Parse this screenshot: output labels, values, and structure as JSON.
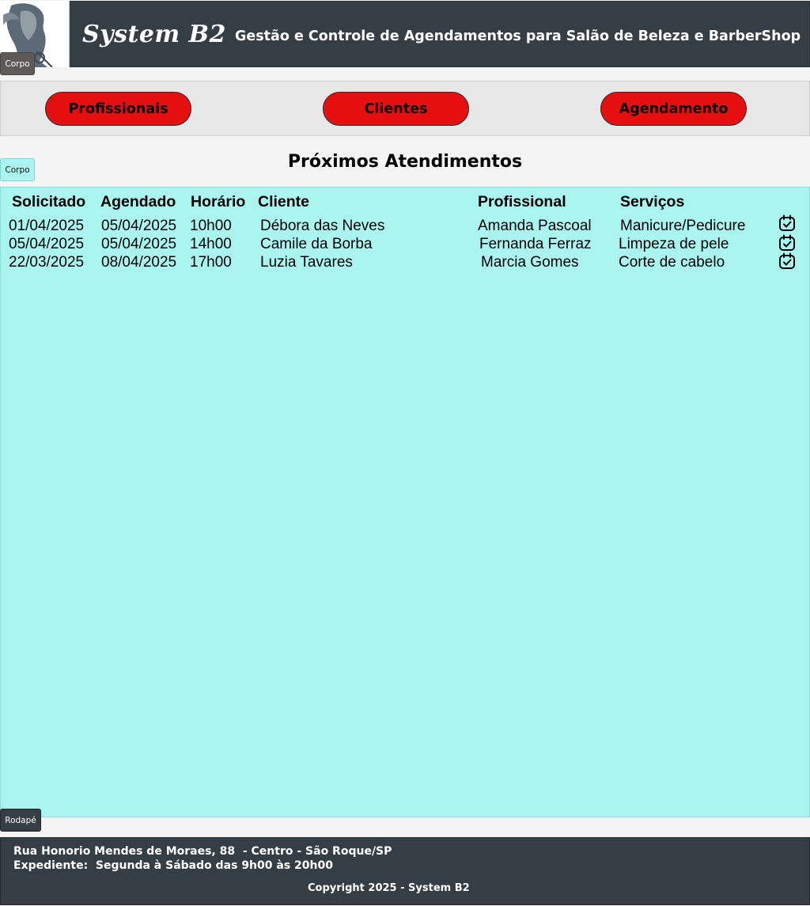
{
  "header": {
    "brand": "System B2",
    "tagline": "Gestão e Controle de Agendamentos para Salão de Beleza e BarberShop",
    "logo_icon": "salon-logo-icon",
    "tag_label": "Corpo"
  },
  "nav": {
    "buttons": [
      {
        "label": "Profissionais"
      },
      {
        "label": "Clientes"
      },
      {
        "label": "Agendamento"
      }
    ],
    "button_color": "#e60f10"
  },
  "body_tag": "Corpo",
  "section_title": "Próximos Atendimentos",
  "table": {
    "headers": {
      "solicitado": "Solicitado",
      "agendado": "Agendado",
      "horario": "Horário",
      "cliente": "Cliente",
      "profissional": "Profissional",
      "servicos": "Serviços"
    },
    "rows": [
      {
        "solicitado": "01/04/2025",
        "agendado": "05/04/2025",
        "horario": "10h00",
        "cliente": "Débora das Neves",
        "profissional": "Amanda Pascoal",
        "servico": "Manicure/Pedicure",
        "action_icon": "calendar-check-icon"
      },
      {
        "solicitado": "05/04/2025",
        "agendado": "05/04/2025",
        "horario": "14h00",
        "cliente": "Camile da Borba",
        "profissional": "Fernanda Ferraz",
        "servico": "Limpeza de pele",
        "action_icon": "calendar-check-icon"
      },
      {
        "solicitado": "22/03/2025",
        "agendado": "08/04/2025",
        "horario": "17h00",
        "cliente": "Luzia Tavares",
        "profissional": "Marcia Gomes",
        "servico": "Corte de cabelo",
        "action_icon": "calendar-check-icon"
      }
    ]
  },
  "footer": {
    "tag_label": "Rodapé",
    "address": "Rua Honorio Mendes de Moraes, 88  - Centro - São Roque/SP",
    "hours": "Expediente:  Segunda à Sábado das 9h00 às 20h00",
    "copyright": "Copyright 2025 - System B2"
  },
  "colors": {
    "header_bg": "#363e45",
    "panel_bg": "#abf5f0",
    "nav_bg": "#e8e7e8"
  }
}
